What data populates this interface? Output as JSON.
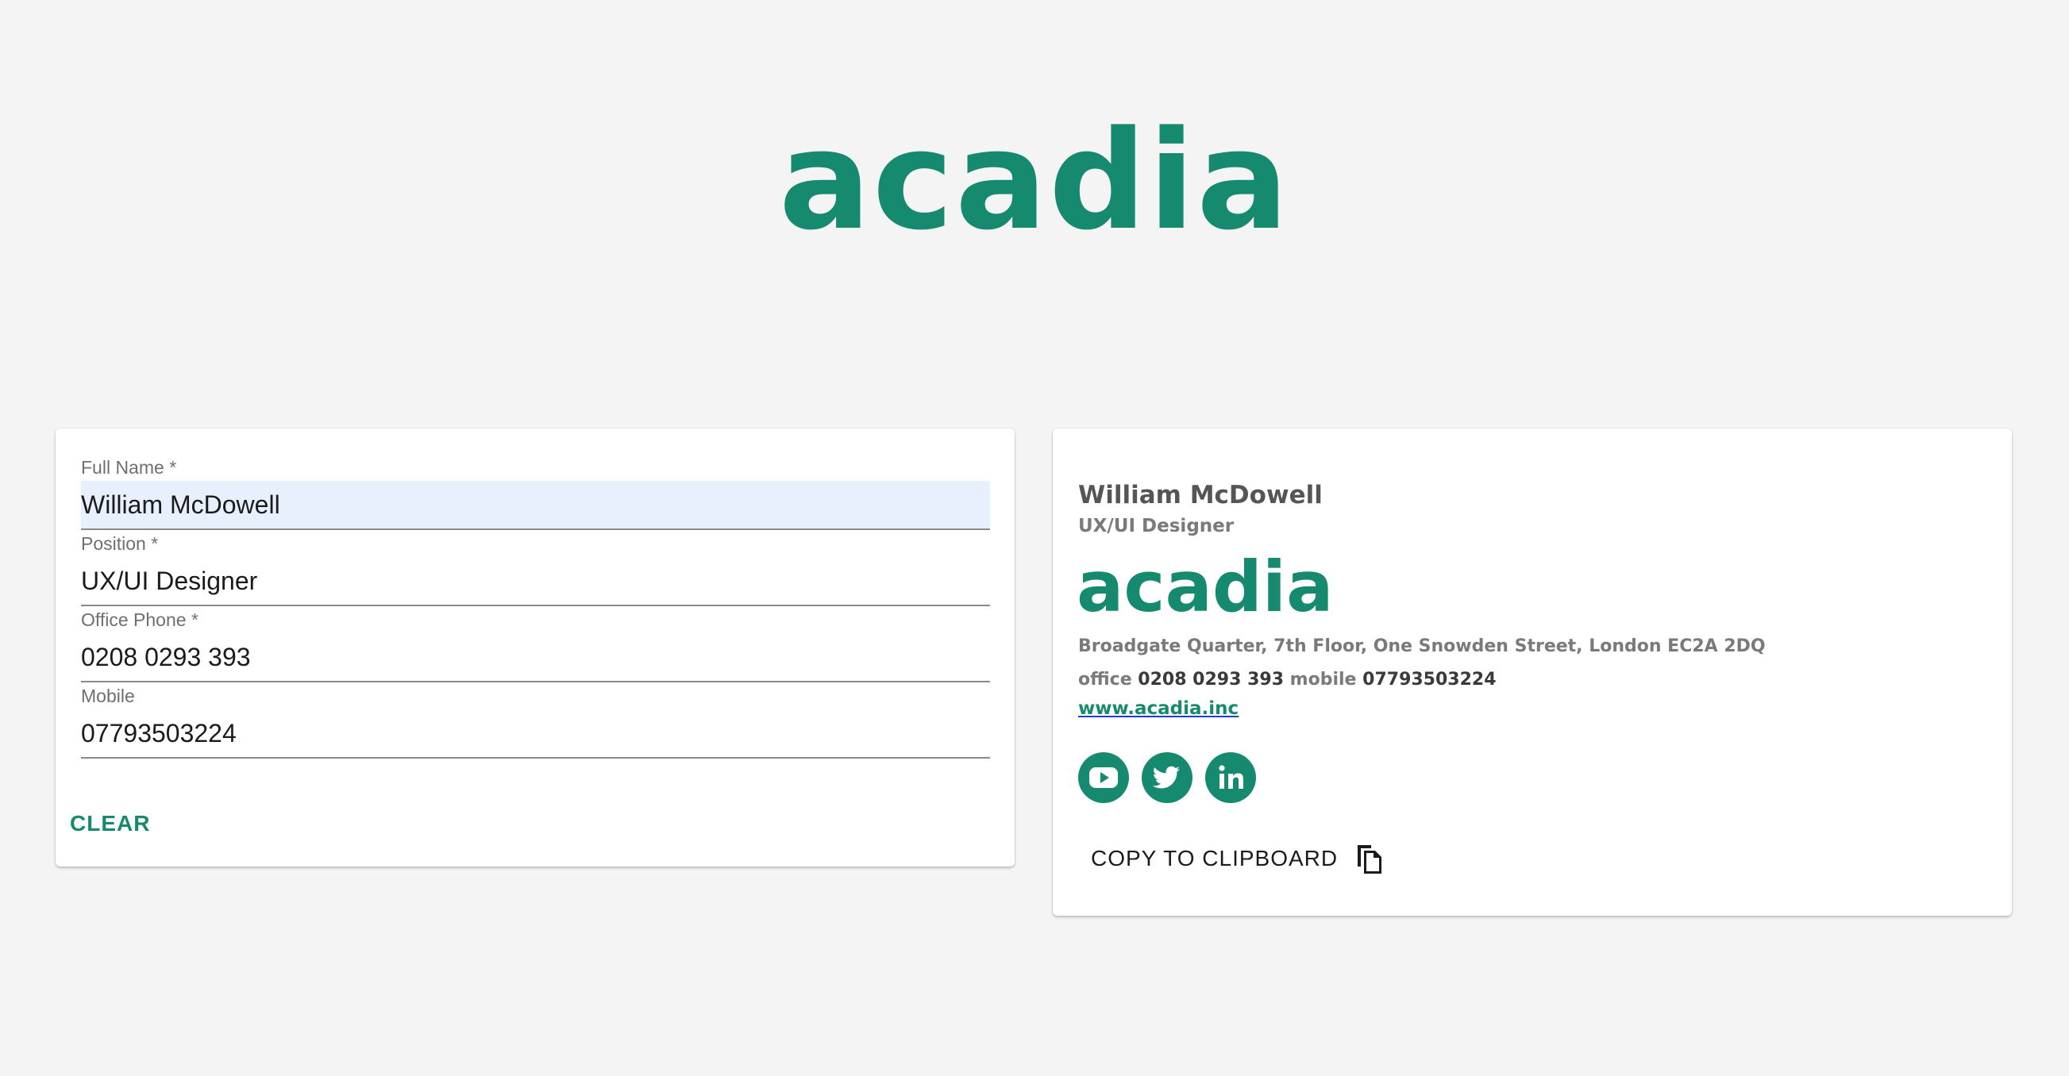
{
  "header": {
    "logo_text": "acadia"
  },
  "form": {
    "fields": [
      {
        "label": "Full Name *",
        "value": "William McDowell"
      },
      {
        "label": "Position *",
        "value": "UX/UI Designer"
      },
      {
        "label": "Office Phone *",
        "value": "0208 0293 393"
      },
      {
        "label": "Mobile",
        "value": "07793503224"
      }
    ],
    "clear_label": "CLEAR"
  },
  "signature": {
    "name": "William McDowell",
    "title": "UX/UI Designer",
    "logo_text": "acadia",
    "address": "Broadgate Quarter, 7th Floor, One Snowden Street, London EC2A 2DQ",
    "office_label": "office",
    "office_phone": "0208 0293 393",
    "mobile_label": "mobile",
    "mobile_phone": "07793503224",
    "website": "www.acadia.inc",
    "social_icons": [
      "youtube-icon",
      "twitter-icon",
      "linkedin-icon"
    ],
    "copy_label": "COPY TO CLIPBOARD"
  },
  "colors": {
    "brand": "#168a6e",
    "background": "#f4f4f4",
    "autofill": "#e8f0fe"
  }
}
